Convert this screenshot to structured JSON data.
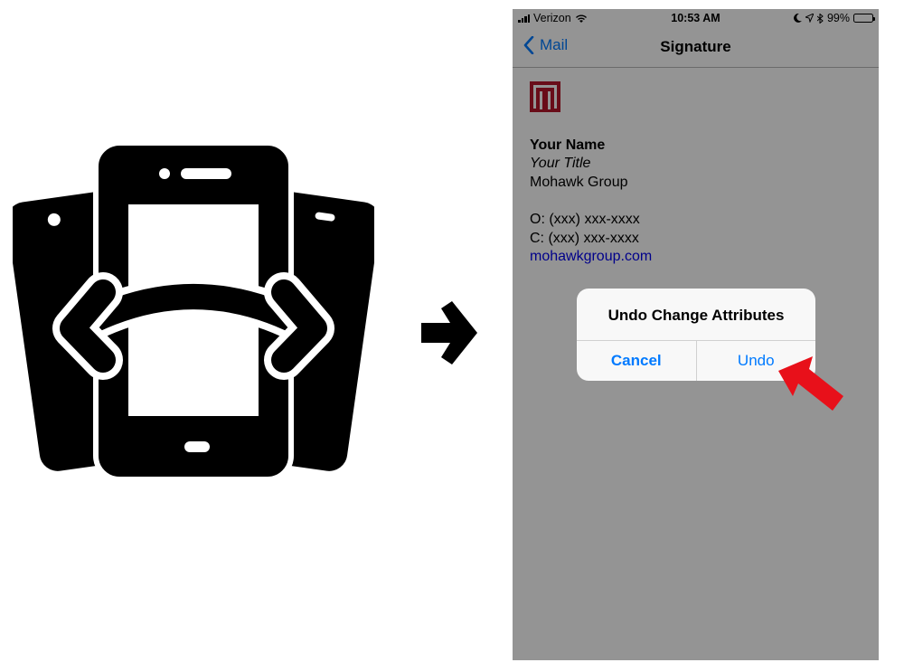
{
  "status_bar": {
    "carrier": "Verizon",
    "time": "10:53 AM",
    "battery": "99%",
    "battery_level": 0.99
  },
  "nav": {
    "back_label": "Mail",
    "title": "Signature"
  },
  "signature": {
    "name": "Your Name",
    "title": "Your Title",
    "company": "Mohawk Group",
    "office_phone": "O: (xxx) xxx-xxxx",
    "cell_phone": "C: (xxx) xxx-xxxx",
    "website": "mohawkgroup.com"
  },
  "alert": {
    "title": "Undo Change Attributes",
    "cancel_label": "Cancel",
    "undo_label": "Undo"
  },
  "colors": {
    "ios_blue": "#007aff",
    "logo_red": "#b5182b",
    "pointer_red": "#e8101a",
    "link": "#0000ee"
  },
  "icons": [
    "shake-phone-icon",
    "arrow-right-icon",
    "back-chevron-icon",
    "wifi-icon",
    "moon-icon",
    "location-icon",
    "bluetooth-icon",
    "battery-icon",
    "mohawk-logo",
    "pointer-arrow-icon"
  ]
}
